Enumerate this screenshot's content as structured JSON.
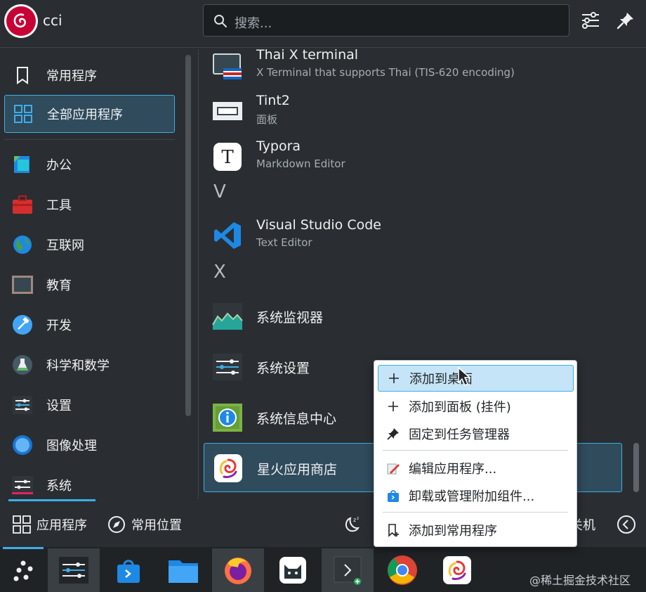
{
  "header": {
    "username": "cci",
    "search_placeholder": "搜索..."
  },
  "sidebar": {
    "items": [
      {
        "label": "常用程序",
        "icon": "bookmark-icon"
      },
      {
        "label": "全部应用程序",
        "icon": "grid-icon"
      },
      {
        "label": "办公",
        "icon": "office-icon"
      },
      {
        "label": "工具",
        "icon": "toolbox-icon"
      },
      {
        "label": "互联网",
        "icon": "globe-icon"
      },
      {
        "label": "教育",
        "icon": "chalkboard-icon"
      },
      {
        "label": "开发",
        "icon": "hammer-icon"
      },
      {
        "label": "科学和数学",
        "icon": "flask-icon"
      },
      {
        "label": "设置",
        "icon": "settings-icon"
      },
      {
        "label": "图像处理",
        "icon": "graphics-icon"
      },
      {
        "label": "系统",
        "icon": "system-icon"
      }
    ]
  },
  "apps": [
    {
      "name": "Thai X terminal",
      "desc": "X Terminal that supports Thai (TIS-620 encoding)"
    },
    {
      "name": "Tint2",
      "desc": "面板"
    },
    {
      "name": "Typora",
      "desc": "Markdown Editor"
    },
    {
      "name": "Visual Studio Code",
      "desc": "Text Editor"
    },
    {
      "name": "系统监视器"
    },
    {
      "name": "系统设置"
    },
    {
      "name": "系统信息中心"
    },
    {
      "name": "星火应用商店"
    }
  ],
  "letters": [
    "V",
    "X"
  ],
  "bottom": {
    "apps_tab": "应用程序",
    "places_tab": "常用位置",
    "shutdown_partial": "关机"
  },
  "context_menu": {
    "items": [
      {
        "label": "添加到桌面",
        "icon": "plus-icon"
      },
      {
        "label": "添加到面板 (挂件)",
        "icon": "plus-icon"
      },
      {
        "label": "固定到任务管理器",
        "icon": "pin-icon"
      },
      {
        "label": "编辑应用程序...",
        "icon": "edit-icon"
      },
      {
        "label": "卸载或管理附加组件...",
        "icon": "package-icon"
      },
      {
        "label": "添加到常用程序",
        "icon": "bookmark-add-icon"
      }
    ]
  },
  "watermark": "@稀土掘金技术社区",
  "colors": {
    "accent": "#3daee9",
    "background": "#2a2e32",
    "selection": "#2f4b5c"
  }
}
